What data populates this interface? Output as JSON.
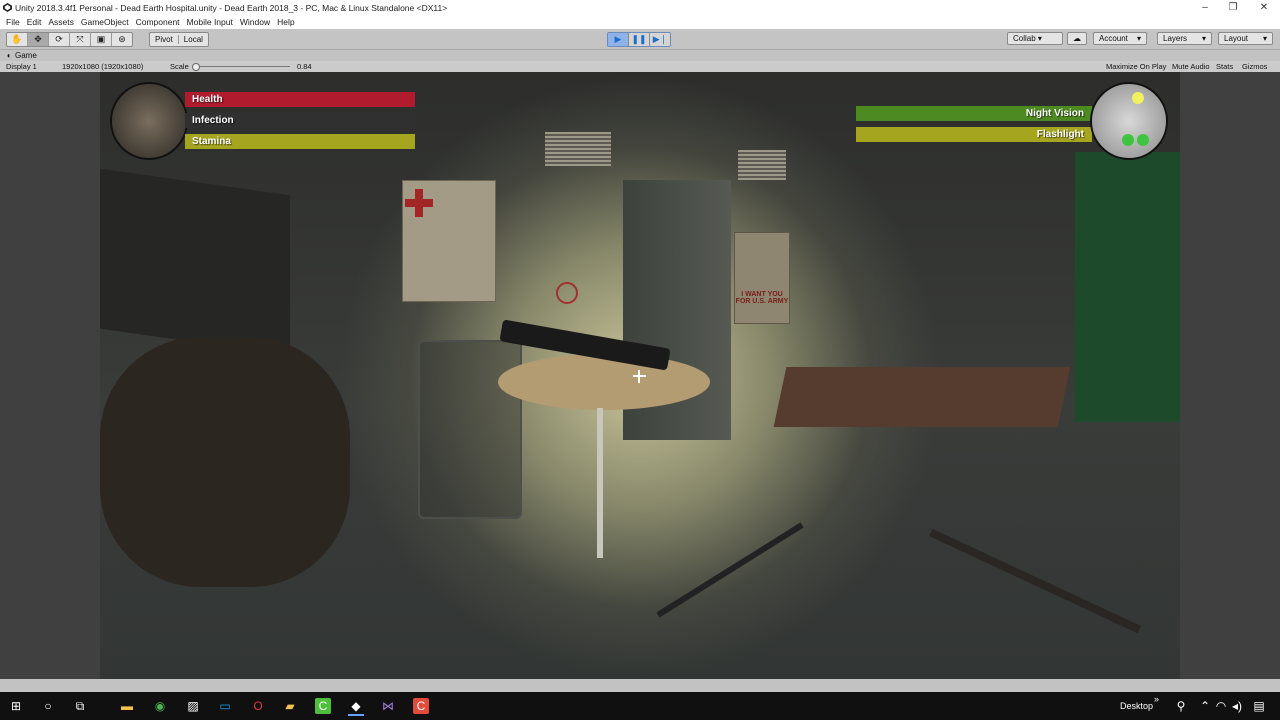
{
  "window": {
    "title": "Unity 2018.3.4f1 Personal - Dead Earth Hospital.unity - Dead Earth 2018_3 - PC, Mac & Linux Standalone <DX11>",
    "minimize": "–",
    "maximize": "❐",
    "close": "✕"
  },
  "menu": [
    "File",
    "Edit",
    "Assets",
    "GameObject",
    "Component",
    "Mobile Input",
    "Window",
    "Help"
  ],
  "toolbar": {
    "pivot": "Pivot",
    "local": "Local",
    "collab": "Collab ▾",
    "account": "Account",
    "layers": "Layers",
    "layout": "Layout"
  },
  "game_tab": {
    "label": "Game"
  },
  "game_bar": {
    "display": "Display 1",
    "resolution": "1920x1080 (1920x1080)",
    "scale_label": "Scale",
    "scale_value": "0.84",
    "maximize_on_play": "Maximize On Play",
    "mute_audio": "Mute Audio",
    "stats": "Stats",
    "gizmos": "Gizmos"
  },
  "hud": {
    "health_label": "Health",
    "infection_label": "Infection",
    "stamina_label": "Stamina",
    "health_level": 1.0,
    "infection_level": 0.0,
    "stamina_level": 1.0,
    "night_vision_label": "Night Vision",
    "flashlight_label": "Flashlight",
    "health_color": "#b01c2e",
    "stamina_color": "#a6a51f",
    "night_vision_color": "#4e8a22",
    "flashlight_color": "#a6a51f"
  },
  "scene": {
    "poster_text": "I WANT YOU FOR U.S. ARMY"
  },
  "taskbar": {
    "desktop_label": "Desktop",
    "chevrons": "»"
  }
}
